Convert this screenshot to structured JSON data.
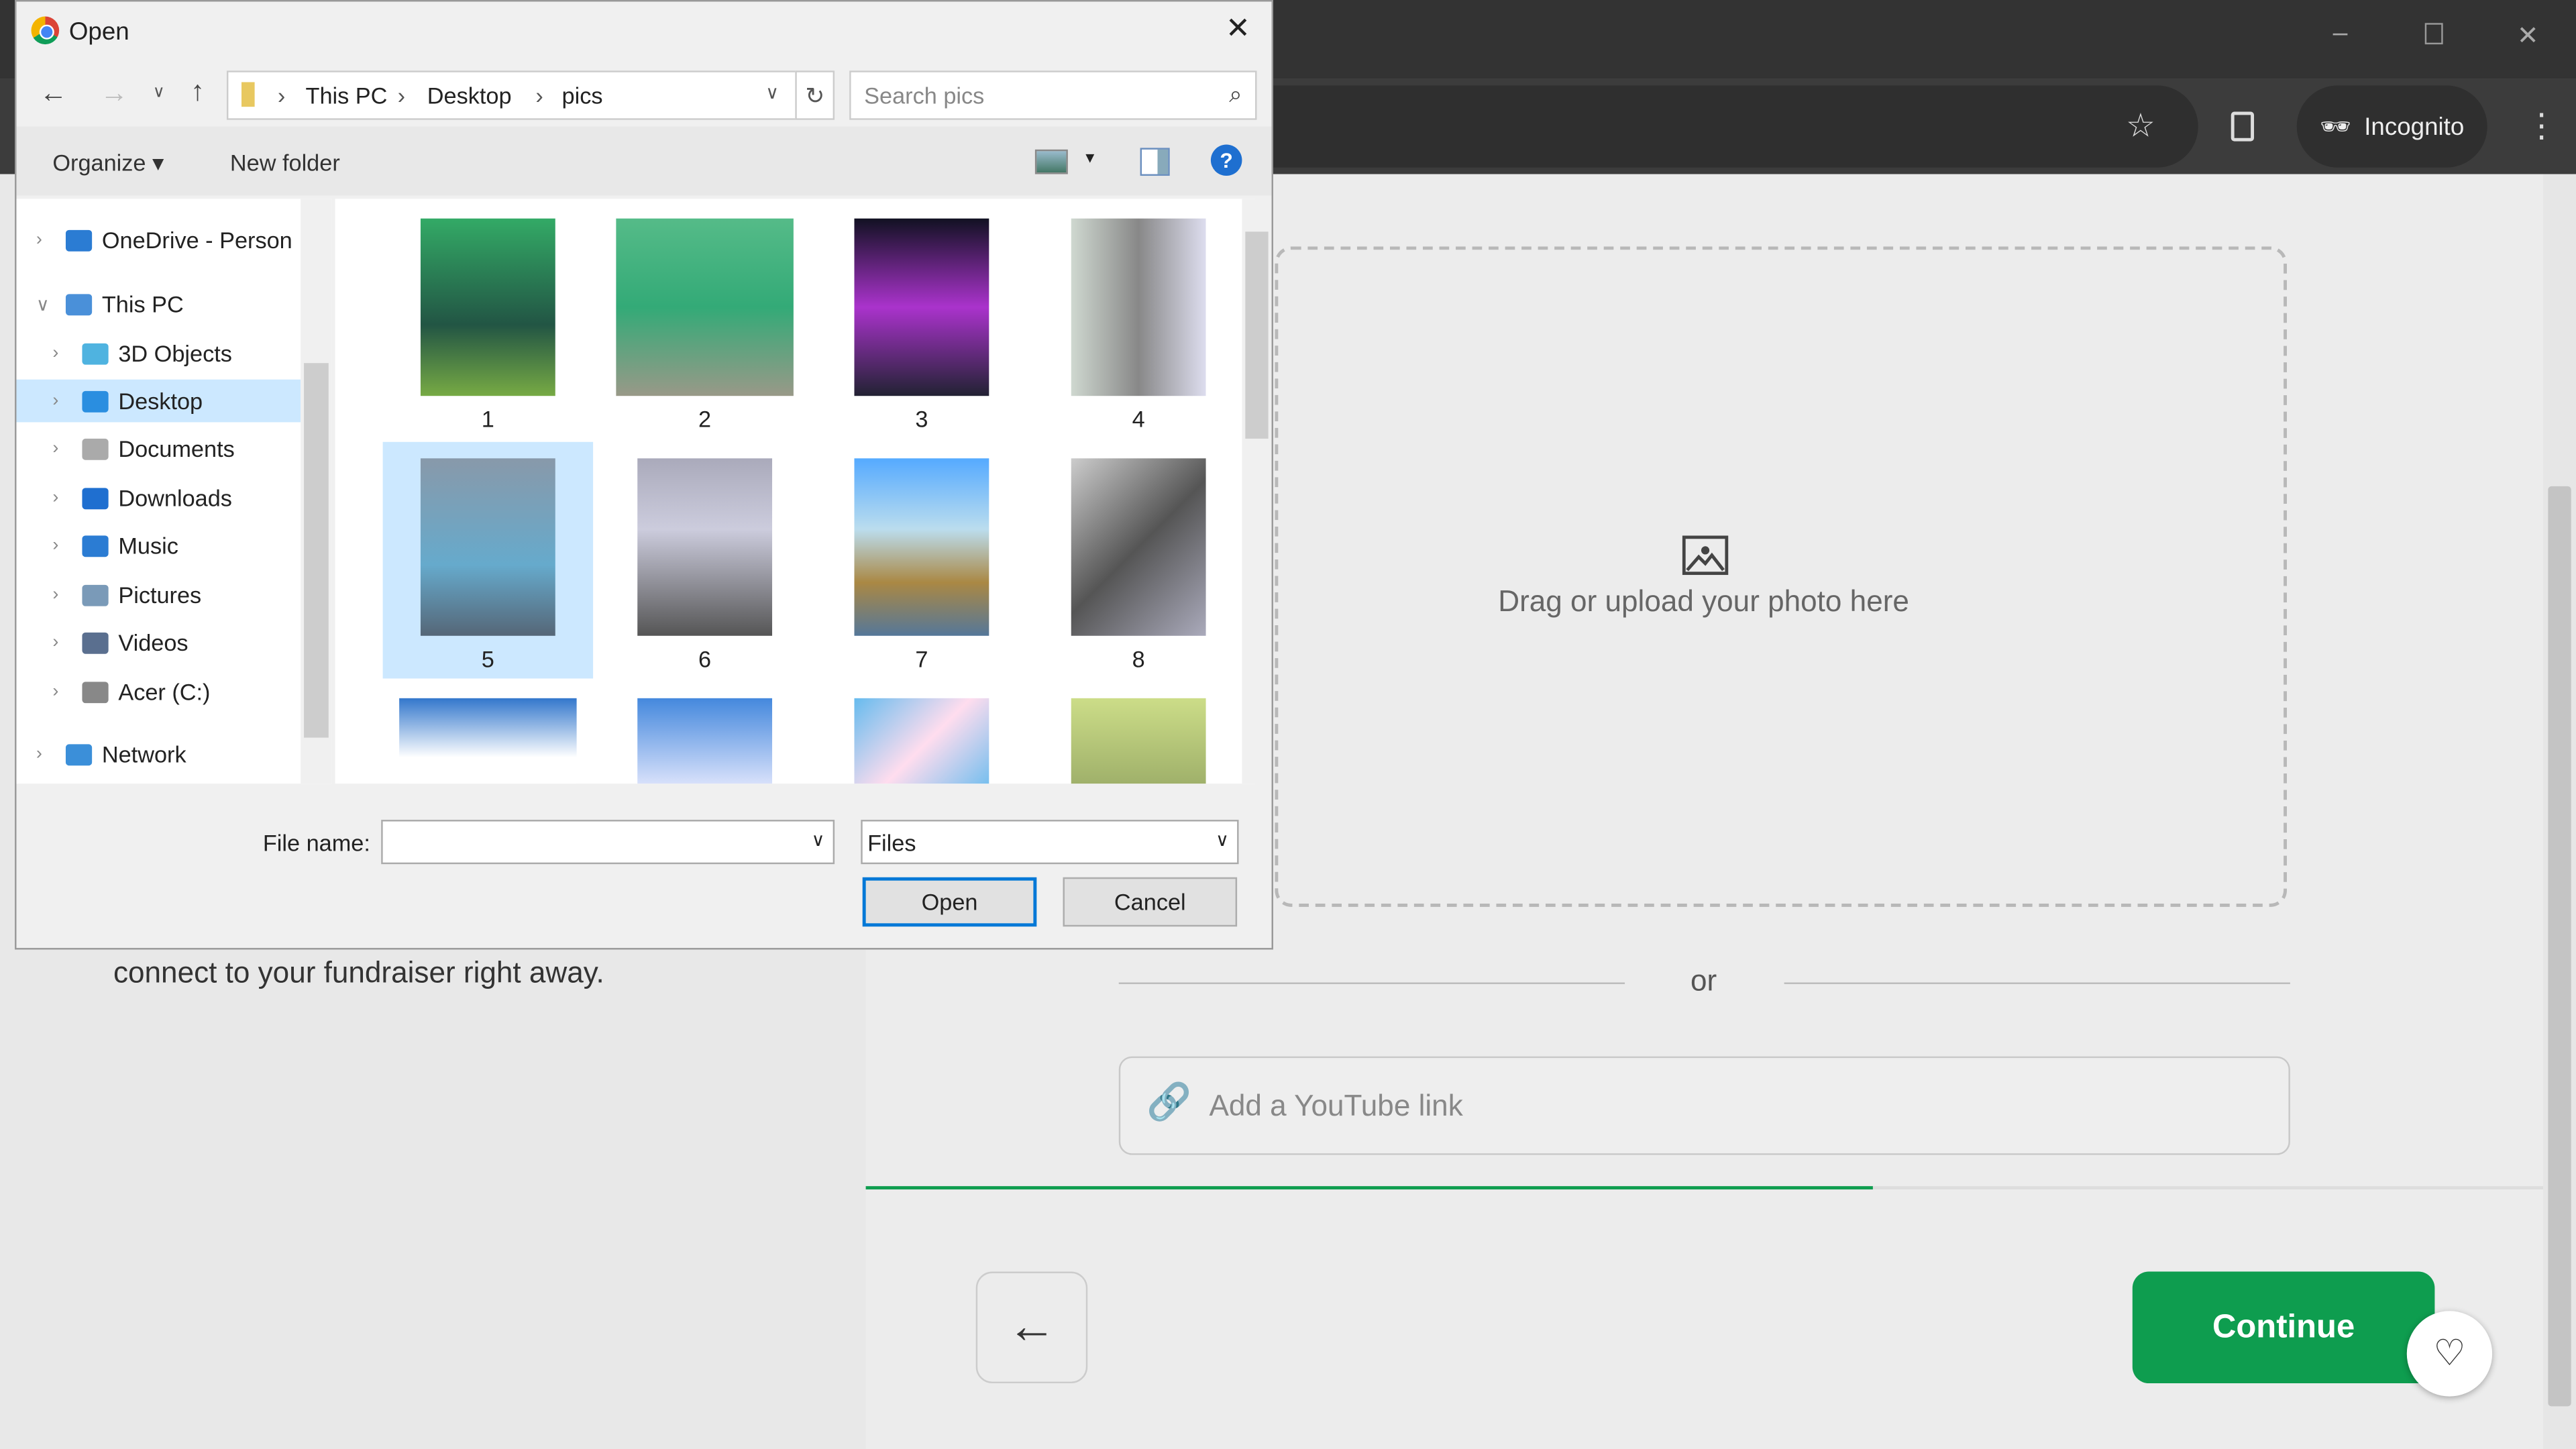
{
  "browser": {
    "incognito_label": "Incognito"
  },
  "page": {
    "left_text": "connect to your fundraiser right away.",
    "dropzone_text": "Drag or upload your photo here",
    "or_label": "or",
    "youtube_placeholder": "Add a YouTube link",
    "continue_label": "Continue",
    "progress_percent": 60,
    "accent": "#0e9d4f"
  },
  "dialog": {
    "title": "Open",
    "breadcrumb": [
      "This PC",
      "Desktop",
      "pics"
    ],
    "search_placeholder": "Search pics",
    "organize_label": "Organize",
    "new_folder_label": "New folder",
    "tree": [
      {
        "label": "OneDrive - Person",
        "icon": "cloud-icon"
      },
      {
        "label": "This PC",
        "icon": "computer-icon"
      },
      {
        "label": "3D Objects",
        "icon": "cube-icon"
      },
      {
        "label": "Desktop",
        "icon": "desktop-icon",
        "selected": true
      },
      {
        "label": "Documents",
        "icon": "document-icon"
      },
      {
        "label": "Downloads",
        "icon": "download-icon"
      },
      {
        "label": "Music",
        "icon": "music-icon"
      },
      {
        "label": "Pictures",
        "icon": "pictures-icon"
      },
      {
        "label": "Videos",
        "icon": "video-icon"
      },
      {
        "label": "Acer (C:)",
        "icon": "drive-icon"
      },
      {
        "label": "Network",
        "icon": "network-icon"
      }
    ],
    "files": [
      "1",
      "2",
      "3",
      "4",
      "5",
      "6",
      "7",
      "8"
    ],
    "selected_file": "5",
    "file_name_label": "File name:",
    "file_name_value": "",
    "file_type": "Files",
    "open_label": "Open",
    "cancel_label": "Cancel"
  }
}
